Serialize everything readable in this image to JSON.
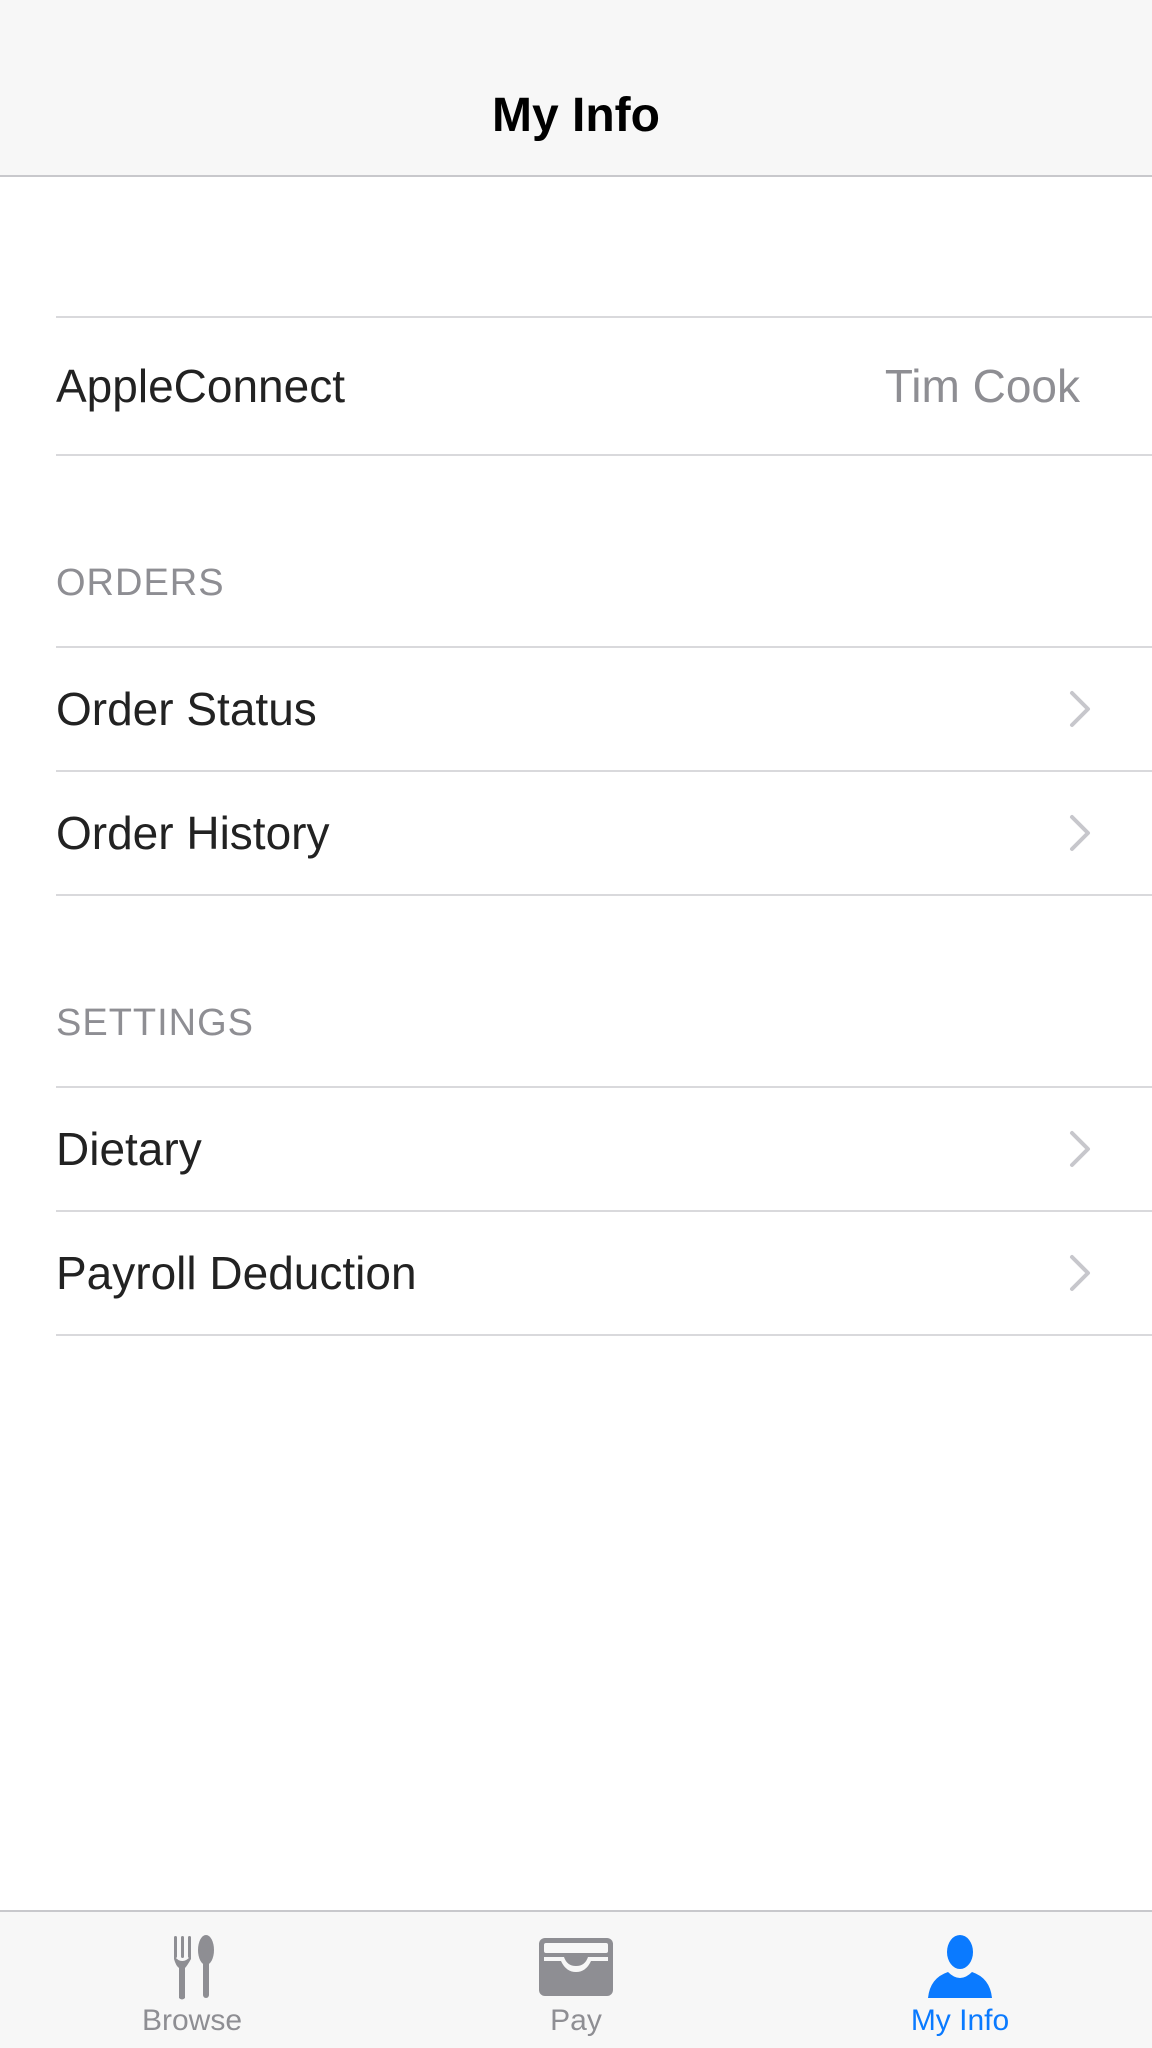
{
  "navbar": {
    "title": "My Info"
  },
  "account": {
    "label": "AppleConnect",
    "value": "Tim Cook"
  },
  "sections": {
    "orders": {
      "header": "ORDERS",
      "items": [
        "Order Status",
        "Order History"
      ]
    },
    "settings": {
      "header": "SETTINGS",
      "items": [
        "Dietary",
        "Payroll Deduction"
      ]
    }
  },
  "tabbar": {
    "tabs": [
      {
        "label": "Browse",
        "icon": "fork-spoon-icon",
        "active": false
      },
      {
        "label": "Pay",
        "icon": "wallet-card-icon",
        "active": false
      },
      {
        "label": "My Info",
        "icon": "person-icon",
        "active": true
      }
    ],
    "active_color": "#0a7aff",
    "inactive_color": "#8e8e93"
  }
}
